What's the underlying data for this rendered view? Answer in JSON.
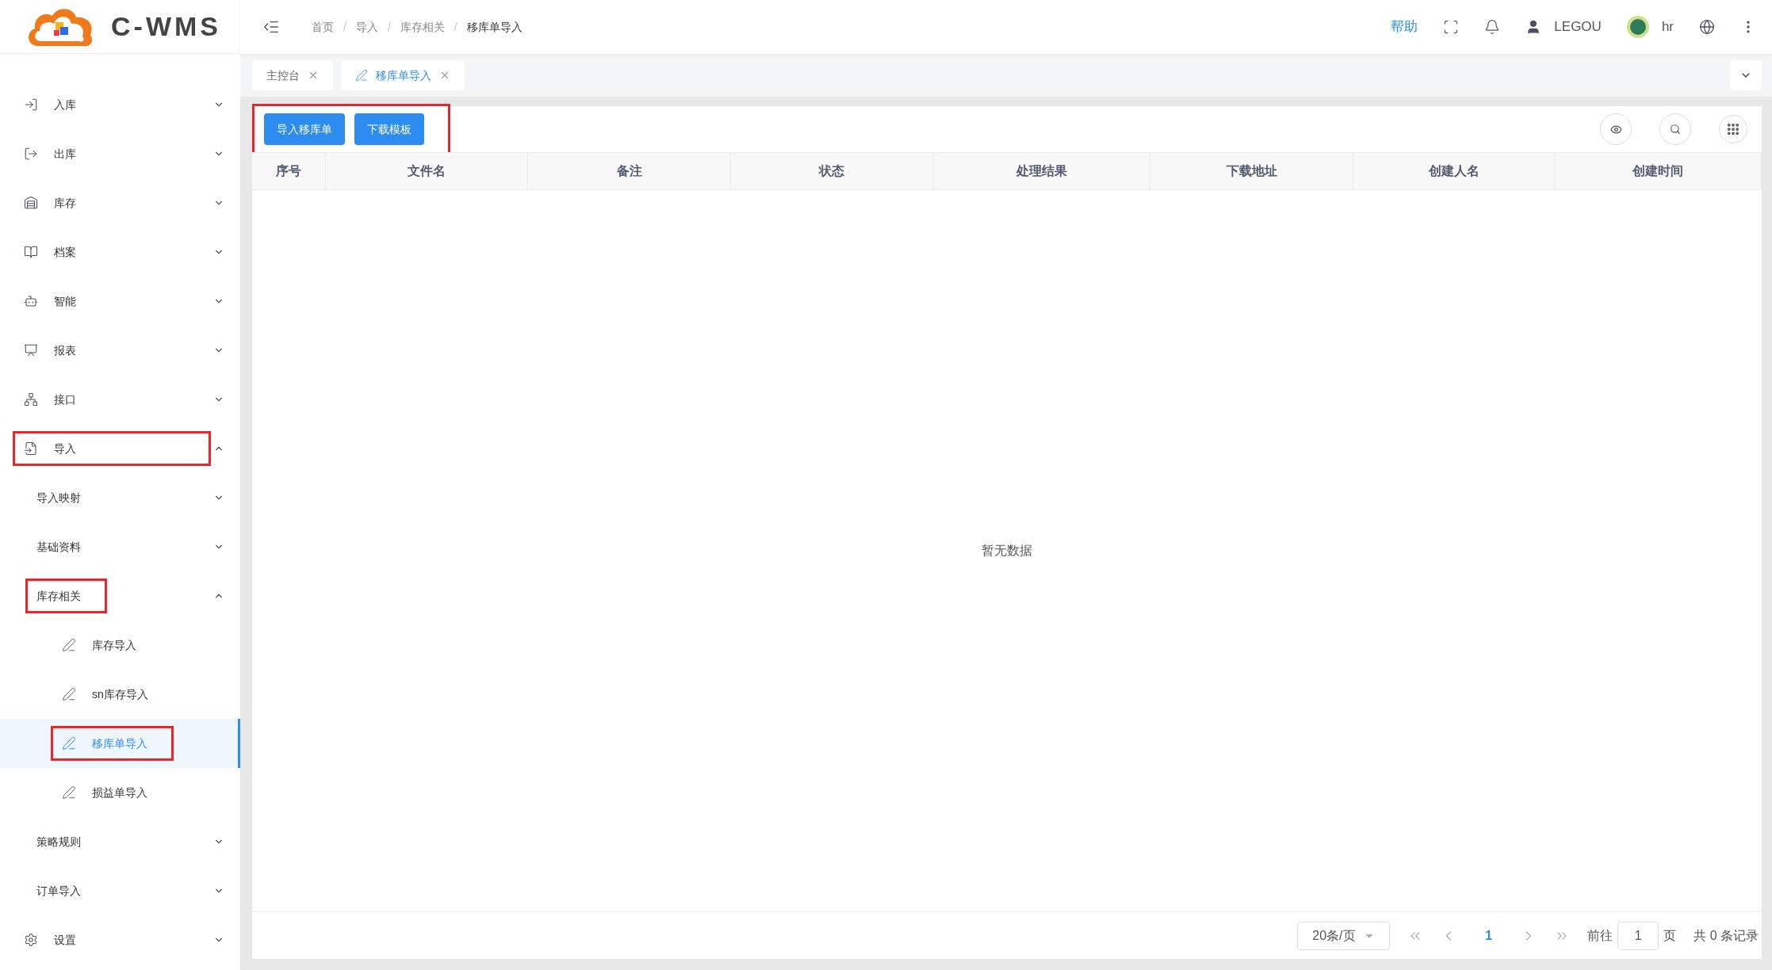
{
  "logo": {
    "text": "C-WMS"
  },
  "header": {
    "breadcrumb": [
      "首页",
      "导入",
      "库存相关",
      "移库单导入"
    ],
    "separator": "/",
    "help": "帮助",
    "user": "LEGOU",
    "account": "hr"
  },
  "tabs": [
    {
      "label": "主控台",
      "selected": false
    },
    {
      "label": "移库单导入",
      "selected": true
    }
  ],
  "sidebar": {
    "items": [
      {
        "label": "入库",
        "expanded": false,
        "highlighted": false
      },
      {
        "label": "出库",
        "expanded": false,
        "highlighted": false
      },
      {
        "label": "库存",
        "expanded": false,
        "highlighted": false
      },
      {
        "label": "档案",
        "expanded": false,
        "highlighted": false
      },
      {
        "label": "智能",
        "expanded": false,
        "highlighted": false
      },
      {
        "label": "报表",
        "expanded": false,
        "highlighted": false
      },
      {
        "label": "接口",
        "expanded": false,
        "highlighted": false
      },
      {
        "label": "导入",
        "expanded": true,
        "highlighted": true,
        "children": [
          {
            "label": "导入映射",
            "expanded": false,
            "highlighted": false
          },
          {
            "label": "基础资料",
            "expanded": false,
            "highlighted": false
          },
          {
            "label": "库存相关",
            "expanded": true,
            "highlighted": true,
            "children": [
              {
                "label": "库存导入",
                "selected": false,
                "highlighted": false
              },
              {
                "label": "sn库存导入",
                "selected": false,
                "highlighted": false
              },
              {
                "label": "移库单导入",
                "selected": true,
                "highlighted": true
              },
              {
                "label": "损益单导入",
                "selected": false,
                "highlighted": false
              }
            ]
          },
          {
            "label": "策略规则",
            "expanded": false,
            "highlighted": false
          },
          {
            "label": "订单导入",
            "expanded": false,
            "highlighted": false
          }
        ]
      },
      {
        "label": "设置",
        "expanded": false,
        "highlighted": false
      }
    ]
  },
  "toolbar": {
    "highlighted": true,
    "buttons": [
      "导入移库单",
      "下载模板"
    ]
  },
  "table": {
    "columns": [
      "序号",
      "文件名",
      "备注",
      "状态",
      "处理结果",
      "下载地址",
      "创建人名",
      "创建时间"
    ],
    "empty_text": "暂无数据"
  },
  "pagination": {
    "page_size": "20条/页",
    "pages": [
      {
        "label": "1",
        "selected": true
      }
    ],
    "goto_label": "前往",
    "goto_value": "1",
    "page_unit": "页",
    "total": "共 0 条记录"
  }
}
